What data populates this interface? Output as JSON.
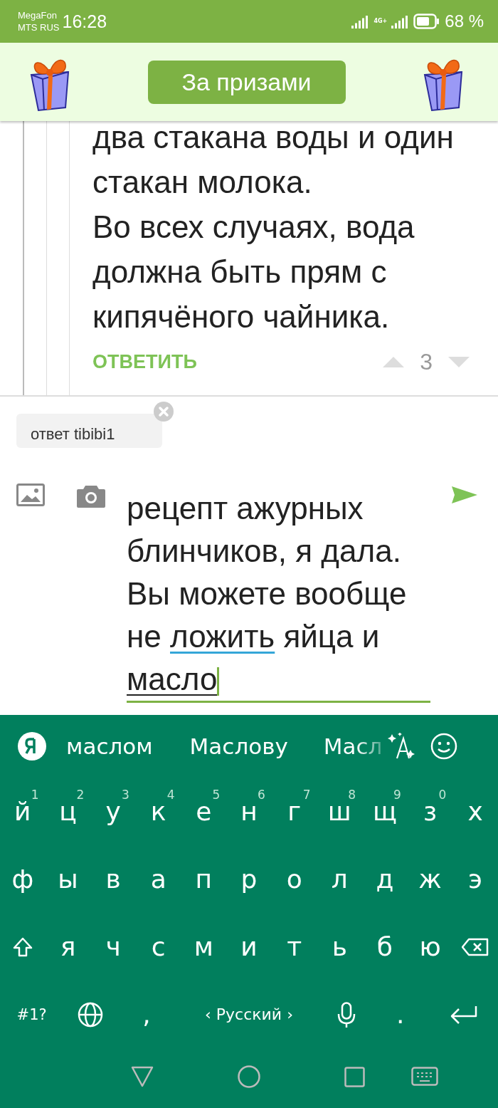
{
  "status_bar": {
    "carriers": [
      "MegaFon",
      "MTS RUS"
    ],
    "time": "16:28",
    "network": "4G+",
    "battery": "68 %"
  },
  "header": {
    "button": "За призами"
  },
  "comment": {
    "lines": [
      "два стакана воды и один",
      "стакан молока.",
      "Во всех случаях, вода",
      "должна быть прям с",
      "кипячёного чайника."
    ],
    "reply": "ОТВЕТИТЬ",
    "votes": "3"
  },
  "reply_chip": {
    "label": "ответ tibibi1"
  },
  "composer": {
    "focused": true,
    "lines": [
      [
        {
          "text": "рецепт ажурных"
        }
      ],
      [
        {
          "text": "блинчиков, я дала."
        }
      ],
      [
        {
          "text": "Вы можете вообще"
        }
      ],
      [
        {
          "text": "не "
        },
        {
          "text": "ложить",
          "misspelled": true
        },
        {
          "text": " яйца и"
        }
      ],
      [
        {
          "text": "масло",
          "composing": true
        }
      ]
    ]
  },
  "keyboard": {
    "suggestions": [
      {
        "text": "маслом",
        "faded": false
      },
      {
        "text": "Маслову",
        "faded": false
      },
      {
        "text": "Масл",
        "faded": true
      }
    ],
    "rows": [
      [
        {
          "kind": "char",
          "label": "й",
          "hint": "1"
        },
        {
          "kind": "char",
          "label": "ц",
          "hint": "2"
        },
        {
          "kind": "char",
          "label": "у",
          "hint": "3"
        },
        {
          "kind": "char",
          "label": "к",
          "hint": "4"
        },
        {
          "kind": "char",
          "label": "е",
          "hint": "5"
        },
        {
          "kind": "char",
          "label": "н",
          "hint": "6"
        },
        {
          "kind": "char",
          "label": "г",
          "hint": "7"
        },
        {
          "kind": "char",
          "label": "ш",
          "hint": "8"
        },
        {
          "kind": "char",
          "label": "щ",
          "hint": "9"
        },
        {
          "kind": "char",
          "label": "з",
          "hint": "0"
        },
        {
          "kind": "char",
          "label": "х"
        }
      ],
      [
        {
          "kind": "char",
          "label": "ф"
        },
        {
          "kind": "char",
          "label": "ы"
        },
        {
          "kind": "char",
          "label": "в"
        },
        {
          "kind": "char",
          "label": "а"
        },
        {
          "kind": "char",
          "label": "п"
        },
        {
          "kind": "char",
          "label": "р"
        },
        {
          "kind": "char",
          "label": "о"
        },
        {
          "kind": "char",
          "label": "л"
        },
        {
          "kind": "char",
          "label": "д"
        },
        {
          "kind": "char",
          "label": "ж"
        },
        {
          "kind": "char",
          "label": "э"
        }
      ],
      [
        {
          "kind": "shift"
        },
        {
          "kind": "char",
          "label": "я"
        },
        {
          "kind": "char",
          "label": "ч"
        },
        {
          "kind": "char",
          "label": "с"
        },
        {
          "kind": "char",
          "label": "м"
        },
        {
          "kind": "char",
          "label": "и"
        },
        {
          "kind": "char",
          "label": "т"
        },
        {
          "kind": "char",
          "label": "ь"
        },
        {
          "kind": "char",
          "label": "б"
        },
        {
          "kind": "char",
          "label": "ю"
        },
        {
          "kind": "backspace"
        }
      ]
    ],
    "bottom_keys": [
      {
        "kind": "symbols",
        "label": "#1?"
      },
      {
        "kind": "globe"
      },
      {
        "kind": "comma",
        "label": ","
      },
      {
        "kind": "space",
        "label": "‹ Русский ›"
      },
      {
        "kind": "mic"
      },
      {
        "kind": "period",
        "label": "."
      },
      {
        "kind": "enter"
      }
    ]
  }
}
